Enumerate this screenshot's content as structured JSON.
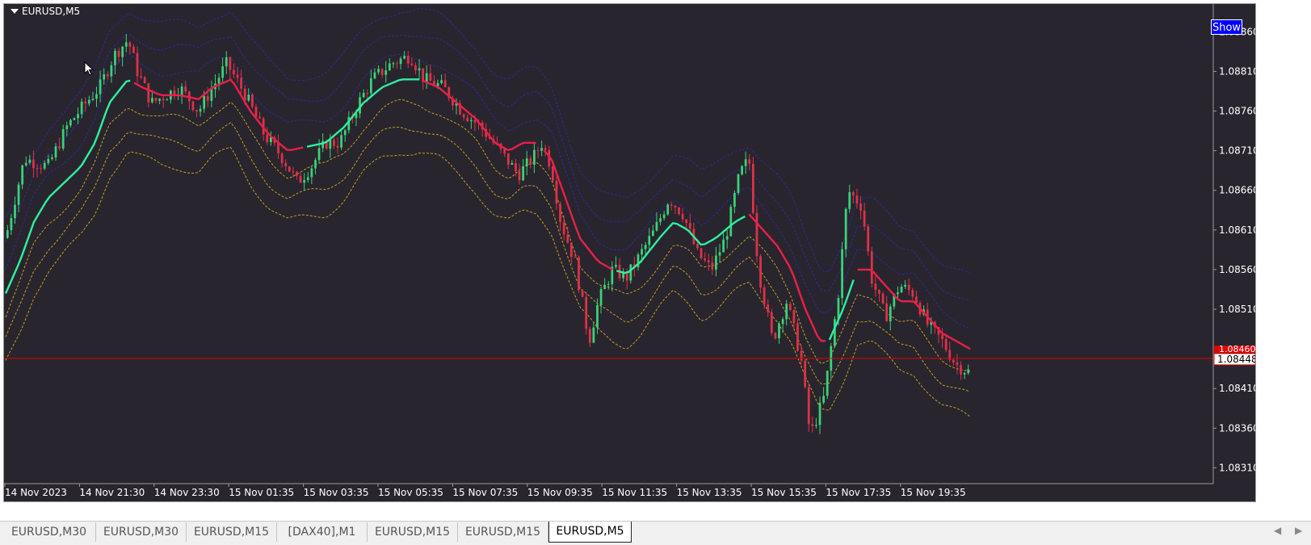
{
  "window": {
    "symbol_title": "EURUSD,M5",
    "show_label": "Show"
  },
  "colors": {
    "background": "#29252e",
    "bull_candle": "#3ad27a",
    "bear_candle": "#e0304a",
    "ma_up": "#2ef0a0",
    "ma_down": "#e8204a",
    "upper_bands": "#2a2aa0",
    "lower_bands": "#c8a020",
    "price_line": "#e00000",
    "axis_text": "#ffffff"
  },
  "tabs": [
    {
      "label": "EURUSD,M30",
      "active": false
    },
    {
      "label": "EURUSD,M30",
      "active": false
    },
    {
      "label": "EURUSD,M15",
      "active": false
    },
    {
      "label": "[DAX40],M1",
      "active": false
    },
    {
      "label": "EURUSD,M15",
      "active": false
    },
    {
      "label": "EURUSD,M15",
      "active": false
    },
    {
      "label": "EURUSD,M5",
      "active": true
    }
  ],
  "tab_nav": {
    "left": "◀",
    "right": "▶"
  },
  "chart_data": {
    "type": "candlestick",
    "symbol": "EURUSD",
    "timeframe": "M5",
    "y_ticks": [
      "1.08860",
      "1.08810",
      "1.08760",
      "1.08710",
      "1.08660",
      "1.08610",
      "1.08560",
      "1.08510",
      "1.08410",
      "1.08360",
      "1.08310"
    ],
    "ylim": [
      1.0829,
      1.08895
    ],
    "x_ticks": [
      "14 Nov 2023",
      "14 Nov 21:30",
      "14 Nov 23:30",
      "15 Nov 01:35",
      "15 Nov 03:35",
      "15 Nov 05:35",
      "15 Nov 07:35",
      "15 Nov 09:35",
      "15 Nov 11:35",
      "15 Nov 13:35",
      "15 Nov 15:35",
      "15 Nov 17:35",
      "15 Nov 19:35"
    ],
    "current_price": "1.08448",
    "current_price_value": 1.08448,
    "hidden_label": "1.08460",
    "hidden_label_value": 1.0846,
    "bar_count": 260,
    "close_path": [
      [
        0,
        1.086
      ],
      [
        8,
        1.087
      ],
      [
        18,
        1.0869
      ],
      [
        26,
        1.0874
      ],
      [
        34,
        1.0877
      ],
      [
        40,
        1.0879
      ],
      [
        46,
        1.0883
      ],
      [
        52,
        1.0885
      ],
      [
        56,
        1.0881
      ],
      [
        62,
        1.0877
      ],
      [
        68,
        1.0878
      ],
      [
        74,
        1.0879
      ],
      [
        82,
        1.0876
      ],
      [
        88,
        1.0879
      ],
      [
        94,
        1.0882
      ],
      [
        102,
        1.0878
      ],
      [
        110,
        1.0873
      ],
      [
        118,
        1.087
      ],
      [
        124,
        1.0867
      ],
      [
        130,
        1.0869
      ],
      [
        136,
        1.0872
      ],
      [
        142,
        1.0872
      ],
      [
        150,
        1.0877
      ],
      [
        156,
        1.088
      ],
      [
        164,
        1.0882
      ],
      [
        172,
        1.0883
      ],
      [
        178,
        1.088
      ],
      [
        186,
        1.0879
      ],
      [
        194,
        1.0876
      ],
      [
        202,
        1.0874
      ],
      [
        210,
        1.0871
      ],
      [
        218,
        1.0868
      ],
      [
        224,
        1.087
      ],
      [
        228,
        1.0872
      ],
      [
        232,
        1.0869
      ],
      [
        236,
        1.0862
      ],
      [
        242,
        1.0857
      ],
      [
        248,
        1.0847
      ],
      [
        252,
        1.0852
      ],
      [
        258,
        1.0856
      ],
      [
        264,
        1.0855
      ],
      [
        270,
        1.0858
      ],
      [
        276,
        1.0861
      ],
      [
        282,
        1.0865
      ],
      [
        288,
        1.0863
      ],
      [
        294,
        1.0858
      ],
      [
        300,
        1.0856
      ],
      [
        306,
        1.086
      ],
      [
        312,
        1.0868
      ],
      [
        316,
        1.087
      ],
      [
        320,
        1.0856
      ],
      [
        326,
        1.0847
      ],
      [
        332,
        1.0852
      ],
      [
        338,
        1.0845
      ],
      [
        342,
        1.0835
      ],
      [
        348,
        1.084
      ],
      [
        354,
        1.0853
      ],
      [
        358,
        1.0866
      ],
      [
        364,
        1.0864
      ],
      [
        368,
        1.0855
      ],
      [
        374,
        1.085
      ],
      [
        380,
        1.0854
      ],
      [
        386,
        1.0853
      ],
      [
        392,
        1.0849
      ],
      [
        398,
        1.0847
      ],
      [
        404,
        1.0844
      ],
      [
        410,
        1.0843
      ]
    ],
    "close_path_x_span": 410,
    "ma_path": [
      [
        0,
        1.0853
      ],
      [
        6,
        1.0857
      ],
      [
        12,
        1.0862
      ],
      [
        18,
        1.0865
      ],
      [
        25,
        1.0867
      ],
      [
        32,
        1.0869
      ],
      [
        38,
        1.0872
      ],
      [
        44,
        1.0877
      ],
      [
        52,
        1.088
      ],
      [
        58,
        1.0879
      ],
      [
        66,
        1.0878
      ],
      [
        74,
        1.0878
      ],
      [
        82,
        1.08775
      ],
      [
        88,
        1.0879
      ],
      [
        96,
        1.088
      ],
      [
        104,
        1.0876
      ],
      [
        112,
        1.0873
      ],
      [
        120,
        1.0871
      ],
      [
        128,
        1.08715
      ],
      [
        136,
        1.0872
      ],
      [
        144,
        1.0874
      ],
      [
        152,
        1.0877
      ],
      [
        160,
        1.0879
      ],
      [
        168,
        1.088
      ],
      [
        176,
        1.088
      ],
      [
        184,
        1.0879
      ],
      [
        192,
        1.0877
      ],
      [
        200,
        1.0875
      ],
      [
        208,
        1.0872
      ],
      [
        214,
        1.0871
      ],
      [
        220,
        1.0872
      ],
      [
        226,
        1.0872
      ],
      [
        232,
        1.087
      ],
      [
        238,
        1.0865
      ],
      [
        244,
        1.086
      ],
      [
        252,
        1.0857
      ],
      [
        258,
        1.0856
      ],
      [
        264,
        1.08555
      ],
      [
        270,
        1.0857
      ],
      [
        278,
        1.086
      ],
      [
        284,
        1.0862
      ],
      [
        290,
        1.0861
      ],
      [
        296,
        1.0859
      ],
      [
        302,
        1.086
      ],
      [
        310,
        1.0862
      ],
      [
        316,
        1.0863
      ],
      [
        322,
        1.0861
      ],
      [
        328,
        1.0859
      ],
      [
        334,
        1.0856
      ],
      [
        340,
        1.0851
      ],
      [
        346,
        1.0847
      ],
      [
        350,
        1.0847
      ],
      [
        356,
        1.0851
      ],
      [
        362,
        1.0856
      ],
      [
        368,
        1.0856
      ],
      [
        374,
        1.0854
      ],
      [
        380,
        1.0852
      ],
      [
        386,
        1.0852
      ],
      [
        392,
        1.085
      ],
      [
        398,
        1.0848
      ],
      [
        404,
        1.0847
      ],
      [
        410,
        1.0846
      ]
    ],
    "ma_segments": [
      {
        "from": 0,
        "to": 53,
        "trend": "up"
      },
      {
        "from": 53,
        "to": 128,
        "trend": "down"
      },
      {
        "from": 128,
        "to": 176,
        "trend": "up"
      },
      {
        "from": 176,
        "to": 226,
        "trend": "down"
      },
      {
        "from": 226,
        "to": 228,
        "trend": "up"
      },
      {
        "from": 228,
        "to": 258,
        "trend": "down"
      },
      {
        "from": 258,
        "to": 316,
        "trend": "up"
      },
      {
        "from": 316,
        "to": 350,
        "trend": "down"
      },
      {
        "from": 350,
        "to": 362,
        "trend": "up"
      },
      {
        "from": 362,
        "to": 410,
        "trend": "down"
      }
    ],
    "upper_band_offsets": [
      0.0003,
      0.0006,
      0.0009
    ],
    "lower_band_offsets": [
      0.0003,
      0.0006,
      0.0009
    ],
    "grid": false
  }
}
